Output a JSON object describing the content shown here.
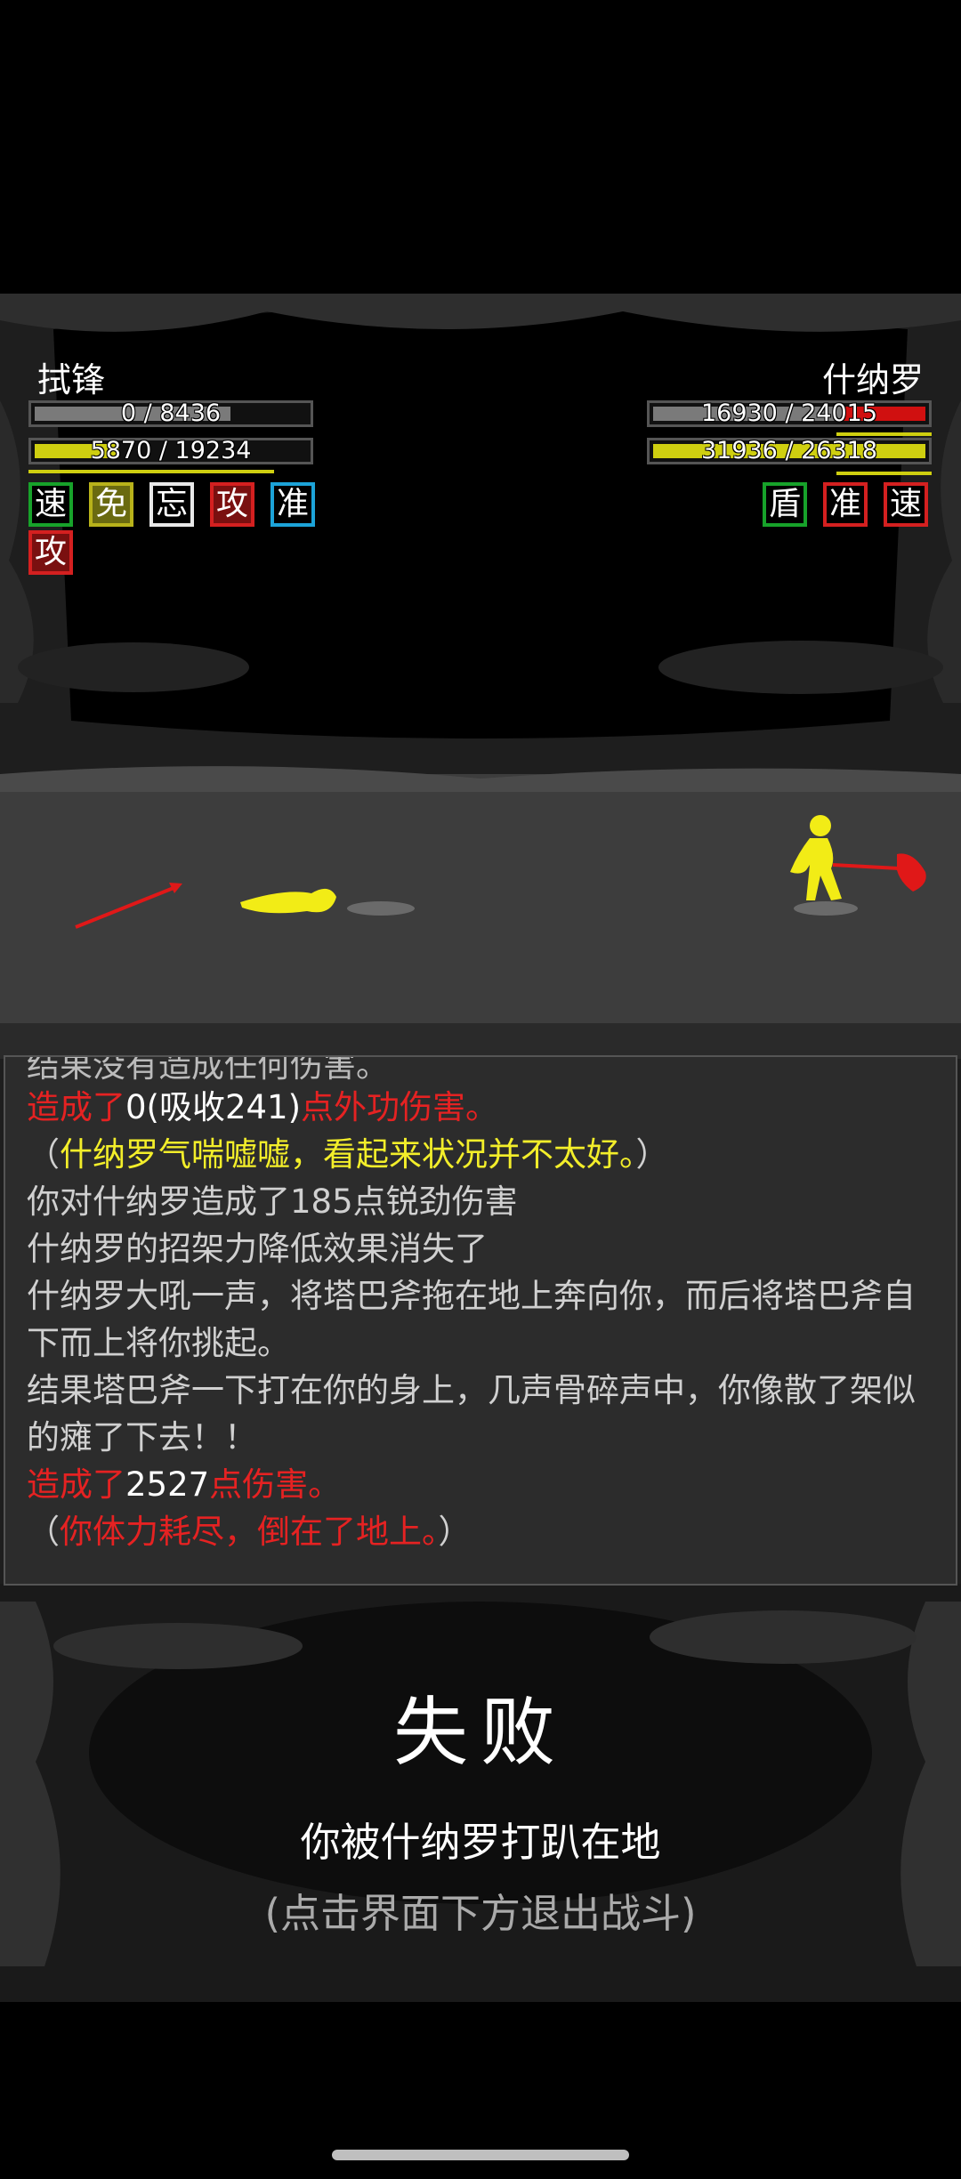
{
  "player": {
    "name": "拭锋",
    "hp_text": "0 / 8436",
    "hp_fraction": 0.0,
    "mp_text": "5870 / 19234",
    "mp_fraction": 0.31,
    "buffs": [
      {
        "char": "速",
        "style": "green"
      },
      {
        "char": "免",
        "style": "yellow"
      },
      {
        "char": "忘",
        "style": "white"
      },
      {
        "char": "攻",
        "style": "red"
      },
      {
        "char": "准",
        "style": "blue"
      },
      {
        "char": "攻",
        "style": "red"
      }
    ]
  },
  "enemy": {
    "name": "什纳罗",
    "hp_text": "16930 / 24015",
    "hp_fraction": 0.7,
    "mp_text": "31936 / 26318",
    "mp_fraction": 1.0,
    "buffs": [
      {
        "char": "盾",
        "style": "green"
      },
      {
        "char": "准",
        "style": "redb"
      },
      {
        "char": "速",
        "style": "redb"
      }
    ]
  },
  "log": {
    "truncated_line": "结果没有造成任何伤害。",
    "line1_a": "造成了",
    "line1_b": "0(吸收241)",
    "line1_c": "点外功伤害。",
    "line2_a": "（",
    "line2_b": "什纳罗气喘嘘嘘，看起来状况并不太好。",
    "line2_c": "）",
    "line3": "你对什纳罗造成了185点锐劲伤害",
    "line4": "什纳罗的招架力降低效果消失了",
    "line5": "什纳罗大吼一声，将塔巴斧拖在地上奔向你，而后将塔巴斧自下而上将你挑起。",
    "line6": "结果塔巴斧一下打在你的身上，几声骨碎声中，你像散了架似的瘫了下去！！",
    "line7_a": "造成了",
    "line7_b": "2527",
    "line7_c": "点伤害。",
    "line8_a": "（",
    "line8_b": "你体力耗尽，倒在了地上。",
    "line8_c": "）"
  },
  "result": {
    "title": "失败",
    "subtitle": "你被什纳罗打趴在地",
    "hint": "(点击界面下方退出战斗)"
  },
  "colors": {
    "hp_fill": "#8f8f8f",
    "enemy_hp_fill": "#d01010",
    "mp_fill": "#cfcf10",
    "damage_red": "#e52222",
    "status_yellow": "#f3ee2a"
  }
}
